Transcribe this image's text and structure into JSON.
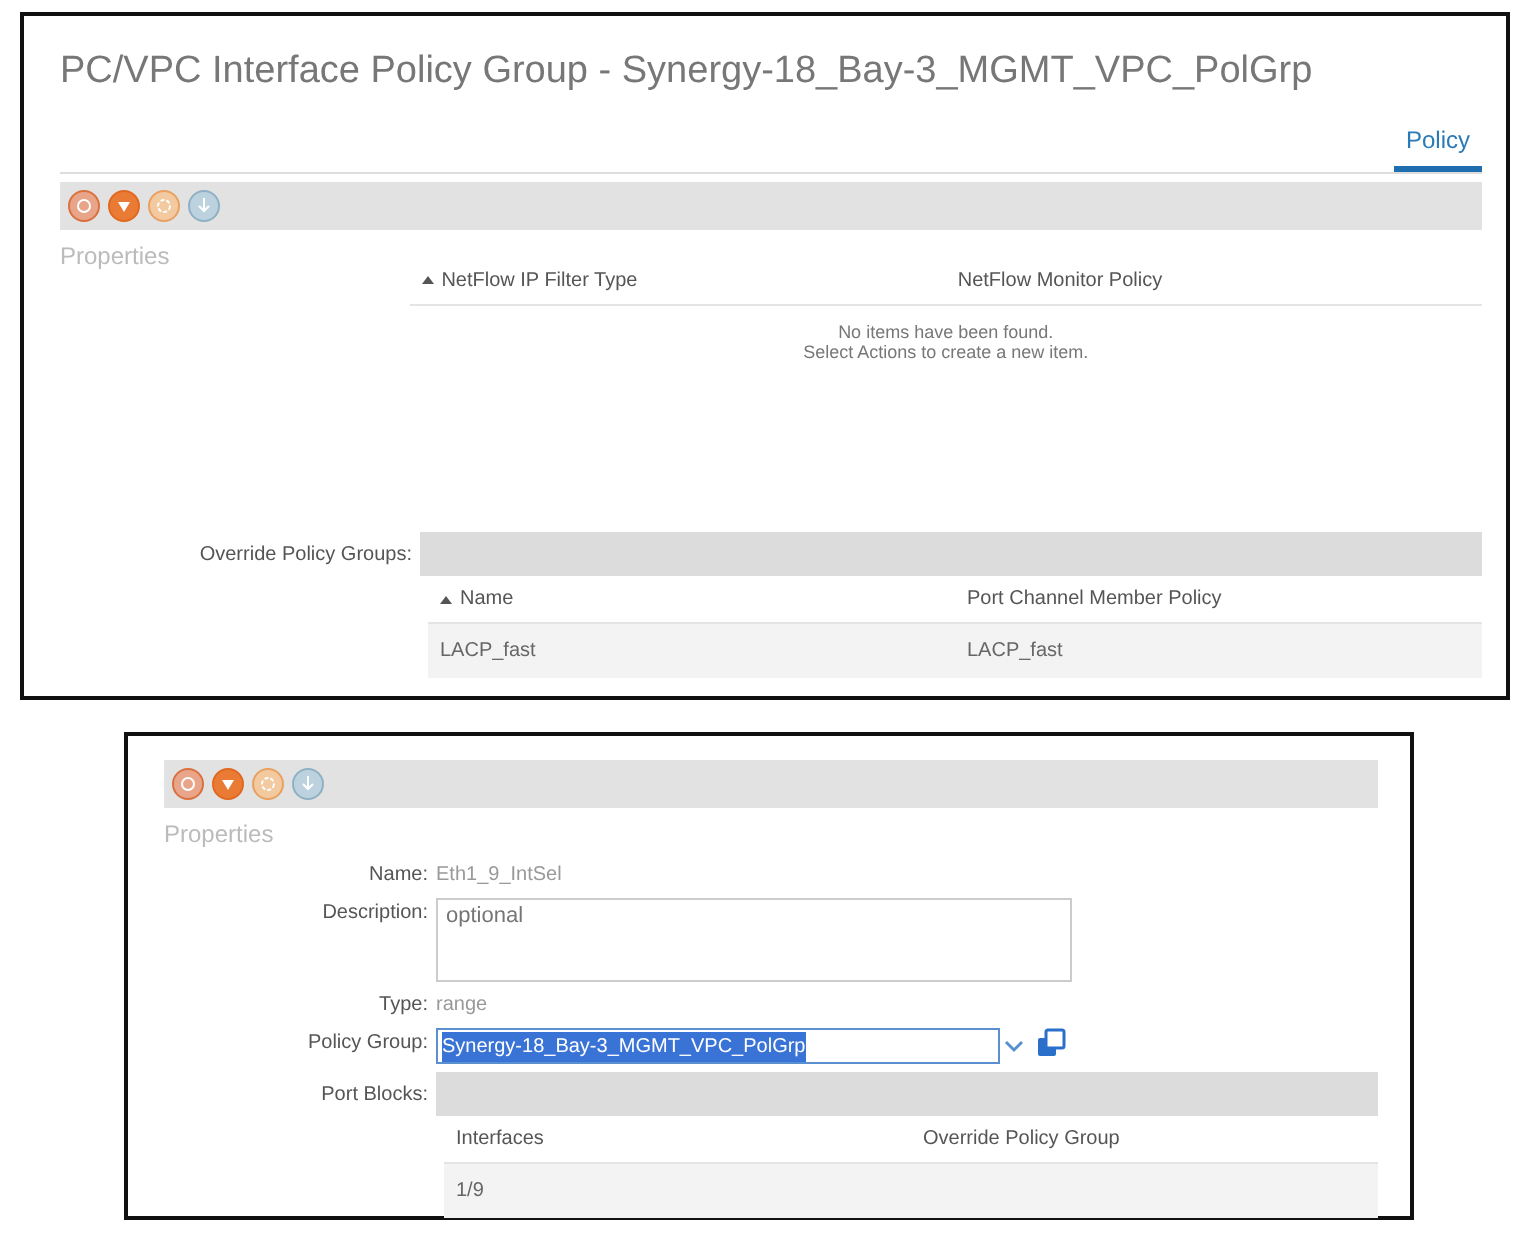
{
  "top_panel": {
    "title": "PC/VPC Interface Policy Group - Synergy-18_Bay-3_MGMT_VPC_PolGrp",
    "tabs": [
      {
        "label": "Policy",
        "selected": true
      }
    ],
    "section_label": "Properties",
    "netflow_table": {
      "columns": [
        {
          "label": "NetFlow IP Filter Type",
          "sorted": true
        },
        {
          "label": "NetFlow Monitor Policy",
          "sorted": false
        }
      ],
      "empty_message": [
        "No items have been found.",
        "Select Actions to create a new item."
      ]
    },
    "override_label": "Override Policy Groups:",
    "override_table": {
      "columns": [
        {
          "label": "Name",
          "sorted": true
        },
        {
          "label": "Port Channel Member Policy",
          "sorted": false
        }
      ],
      "rows": [
        [
          "LACP_fast",
          "LACP_fast"
        ]
      ]
    }
  },
  "bottom_panel": {
    "section_label": "Properties",
    "fields": [
      {
        "kind": "text",
        "label": "Name:",
        "value": "Eth1_9_IntSel"
      },
      {
        "kind": "textarea",
        "label": "Description:",
        "placeholder": "optional"
      },
      {
        "kind": "text",
        "label": "Type:",
        "value": "range"
      },
      {
        "kind": "select",
        "label": "Policy Group:",
        "value": "Synergy-18_Bay-3_MGMT_VPC_PolGrp",
        "highlighted": true
      }
    ],
    "port_blocks_label": "Port Blocks:",
    "port_table": {
      "columns": [
        {
          "label": "Interfaces",
          "sorted": false
        },
        {
          "label": "Override Policy Group",
          "sorted": false
        }
      ],
      "rows": [
        [
          "1/9",
          ""
        ]
      ]
    }
  }
}
